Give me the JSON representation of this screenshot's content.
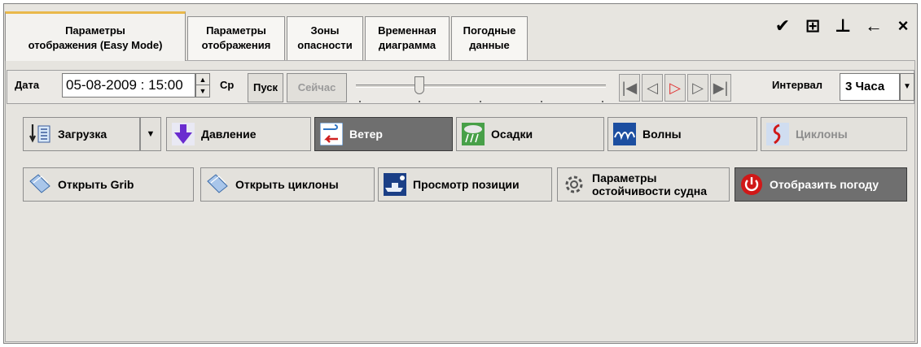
{
  "tabs": [
    {
      "label_line1": "Параметры",
      "label_line2": "отображения (Easy Mode)"
    },
    {
      "label_line1": "Параметры",
      "label_line2": "отображения"
    },
    {
      "label_line1": "Зоны",
      "label_line2": "опасности"
    },
    {
      "label_line1": "Временная",
      "label_line2": "диаграмма"
    },
    {
      "label_line1": "Погодные",
      "label_line2": "данные"
    }
  ],
  "window_controls": [
    {
      "name": "pin-icon",
      "glyph": "✔"
    },
    {
      "name": "restore-icon",
      "glyph": "⊞"
    },
    {
      "name": "dock-icon",
      "glyph": "⊥"
    },
    {
      "name": "back-arrow-icon",
      "glyph": "←"
    },
    {
      "name": "close-icon",
      "glyph": "×"
    }
  ],
  "toolbar": {
    "date_label": "Дата",
    "date_value": "05-08-2009 : 15:00",
    "day_label": "Ср",
    "start_label": "Пуск",
    "now_label": "Сейчас",
    "interval_label": "Интервал",
    "interval_value": "3 Часа"
  },
  "buttons_row1": {
    "load": "Загрузка",
    "pressure": "Давление",
    "wind": "Ветер",
    "precip": "Осадки",
    "waves": "Волны",
    "cyclones": "Циклоны"
  },
  "buttons_row2": {
    "open_grib": "Открыть Grib",
    "open_cyclones": "Открыть циклоны",
    "view_position": "Просмотр позиции",
    "stability_line1": "Параметры",
    "stability_line2": "остойчивости судна",
    "show_weather": "Отобразить погоду"
  },
  "colors": {
    "active_tab_accent": "#e9b84a",
    "toggled_button": "#6f6f6f",
    "power_red": "#d01818",
    "play_red": "#e03030"
  }
}
